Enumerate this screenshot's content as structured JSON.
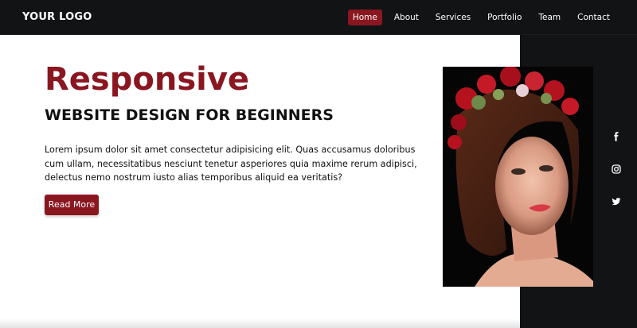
{
  "header": {
    "logo": "YOUR LOGO",
    "nav": [
      {
        "label": "Home",
        "active": true
      },
      {
        "label": "About"
      },
      {
        "label": "Services"
      },
      {
        "label": "Portfolio"
      },
      {
        "label": "Team"
      },
      {
        "label": "Contact"
      }
    ]
  },
  "hero": {
    "title": "Responsive",
    "subtitle": "WEBSITE DESIGN FOR BEGINNERS",
    "body": "Lorem ipsum dolor sit amet consectetur adipisicing elit. Quas accusamus doloribus cum ullam, necessitatibus nesciunt tenetur asperiores quia maxime rerum adipisci, delectus nemo nostrum iusto alias temporibus aliquid ea veritatis?",
    "button_label": "Read More"
  },
  "social": [
    "facebook-icon",
    "instagram-icon",
    "twitter-icon"
  ],
  "colors": {
    "accent": "#8a1620",
    "dark": "#111315"
  }
}
